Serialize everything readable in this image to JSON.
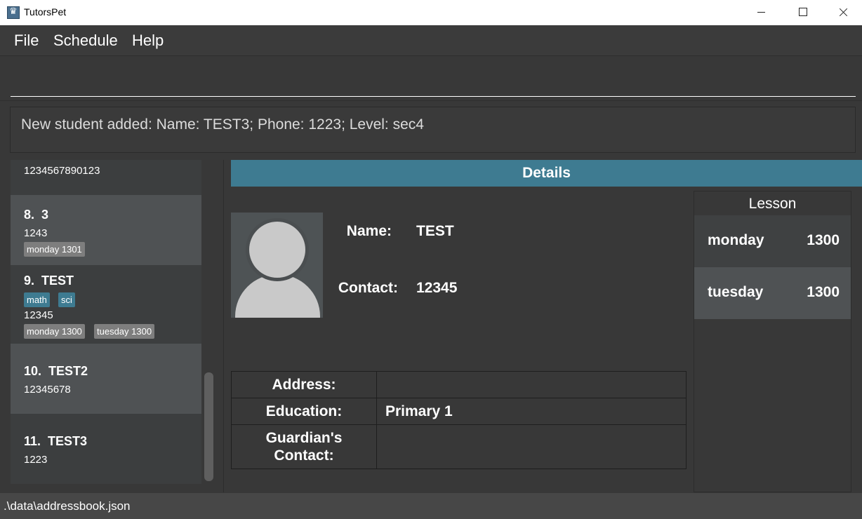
{
  "window": {
    "title": "TutorsPet"
  },
  "menu": {
    "file": "File",
    "schedule": "Schedule",
    "help": "Help"
  },
  "command": {
    "value": ""
  },
  "result": {
    "text": "New student added: Name: TEST3; Phone: 1223; Level: sec4"
  },
  "students": {
    "partial_phone": "1234567890123",
    "items": [
      {
        "title": "8.  3",
        "phone": "1243",
        "subjects": [],
        "lessons": [
          "monday 1301"
        ]
      },
      {
        "title": "9.  TEST",
        "phone": "12345",
        "subjects": [
          "math",
          "sci"
        ],
        "lessons": [
          "monday 1300",
          "tuesday 1300"
        ]
      },
      {
        "title": "10.  TEST2",
        "phone": "12345678",
        "subjects": [],
        "lessons": []
      },
      {
        "title": "11.  TEST3",
        "phone": "1223",
        "subjects": [],
        "lessons": []
      }
    ]
  },
  "details": {
    "header": "Details",
    "name_label": "Name:",
    "name_value": "TEST",
    "contact_label": "Contact:",
    "contact_value": "12345",
    "address_label": "Address:",
    "address_value": "",
    "education_label": "Education:",
    "education_value": "Primary 1",
    "guardian_label": "Guardian's Contact:",
    "guardian_value": ""
  },
  "lesson_panel": {
    "title": "Lesson",
    "items": [
      {
        "day": "monday",
        "time": "1300"
      },
      {
        "day": "tuesday",
        "time": "1300"
      }
    ]
  },
  "status": {
    "path": ".\\data\\addressbook.json"
  },
  "colors": {
    "accent": "#3e7b91",
    "background": "#383838",
    "lesson_tag": "#7e7e7e"
  }
}
